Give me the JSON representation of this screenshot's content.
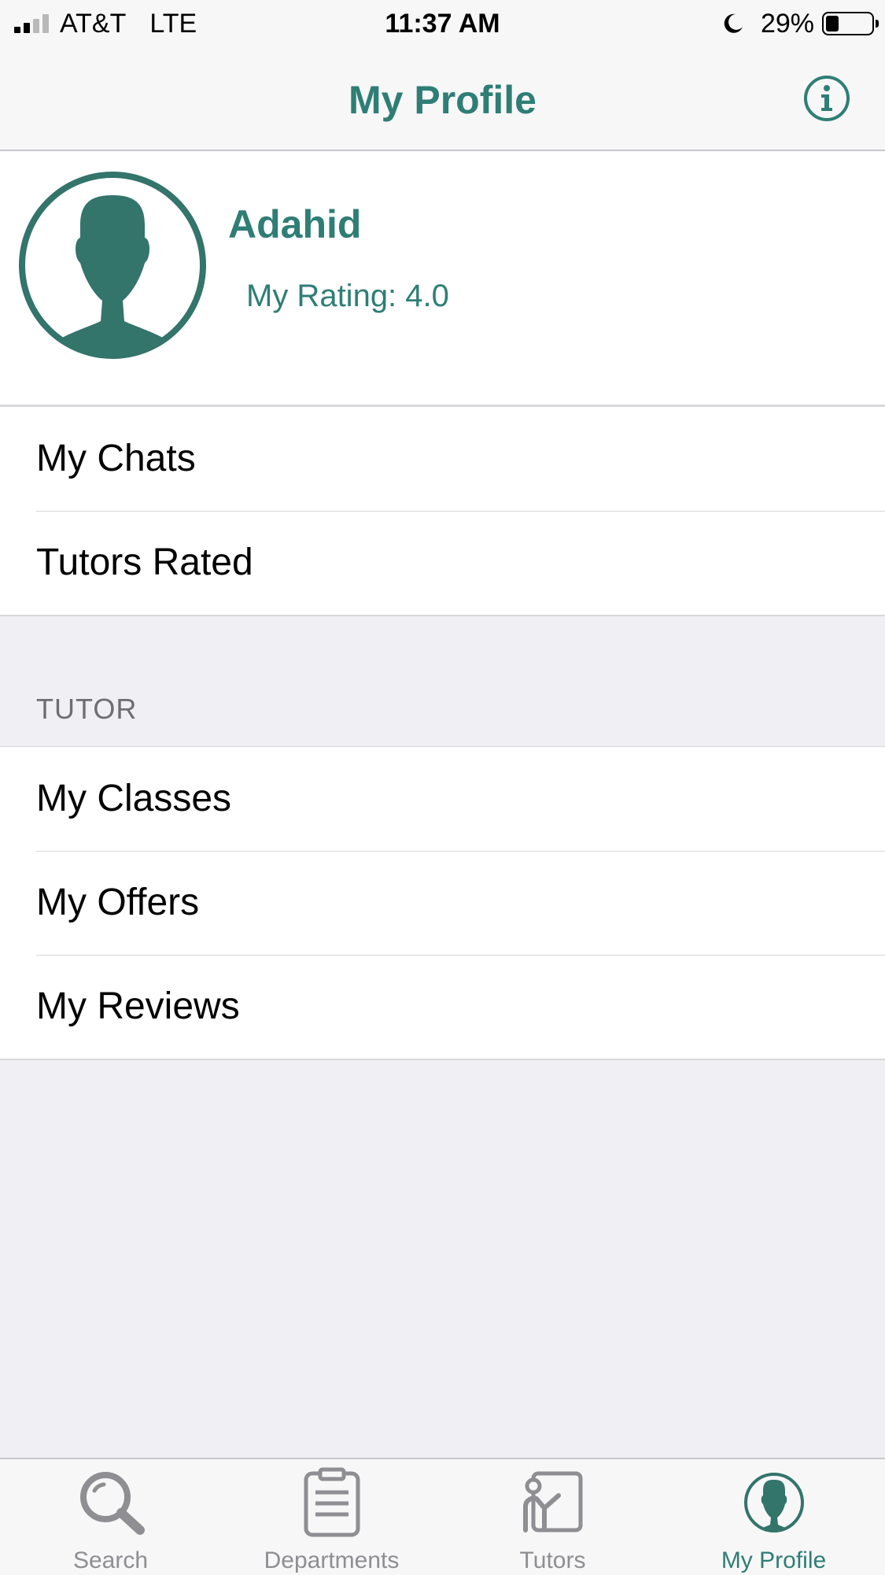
{
  "status_bar": {
    "carrier": "AT&T",
    "network": "LTE",
    "time": "11:37 AM",
    "battery": "29%",
    "battery_level": 0.29
  },
  "nav": {
    "title": "My Profile",
    "info_icon": "info-circle-icon"
  },
  "profile": {
    "name": "Adahid",
    "rating": "My Rating: 4.0",
    "avatar_icon": "person-silhouette-icon"
  },
  "account_items": [
    {
      "label": "My Chats"
    },
    {
      "label": "Tutors Rated"
    }
  ],
  "tutor_section": {
    "header": "TUTOR",
    "items": [
      {
        "label": "My Classes"
      },
      {
        "label": "My Offers"
      },
      {
        "label": "My Reviews"
      }
    ]
  },
  "tab_bar": {
    "tabs": [
      {
        "label": "Search",
        "icon": "magnifier-icon",
        "active": false
      },
      {
        "label": "Departments",
        "icon": "clipboard-list-icon",
        "active": false
      },
      {
        "label": "Tutors",
        "icon": "tutor-board-icon",
        "active": false
      },
      {
        "label": "My Profile",
        "icon": "profile-icon",
        "active": true
      }
    ]
  },
  "colors": {
    "accent": "#2f7e75",
    "inactive": "#8e8e93",
    "background": "#efeff4"
  }
}
